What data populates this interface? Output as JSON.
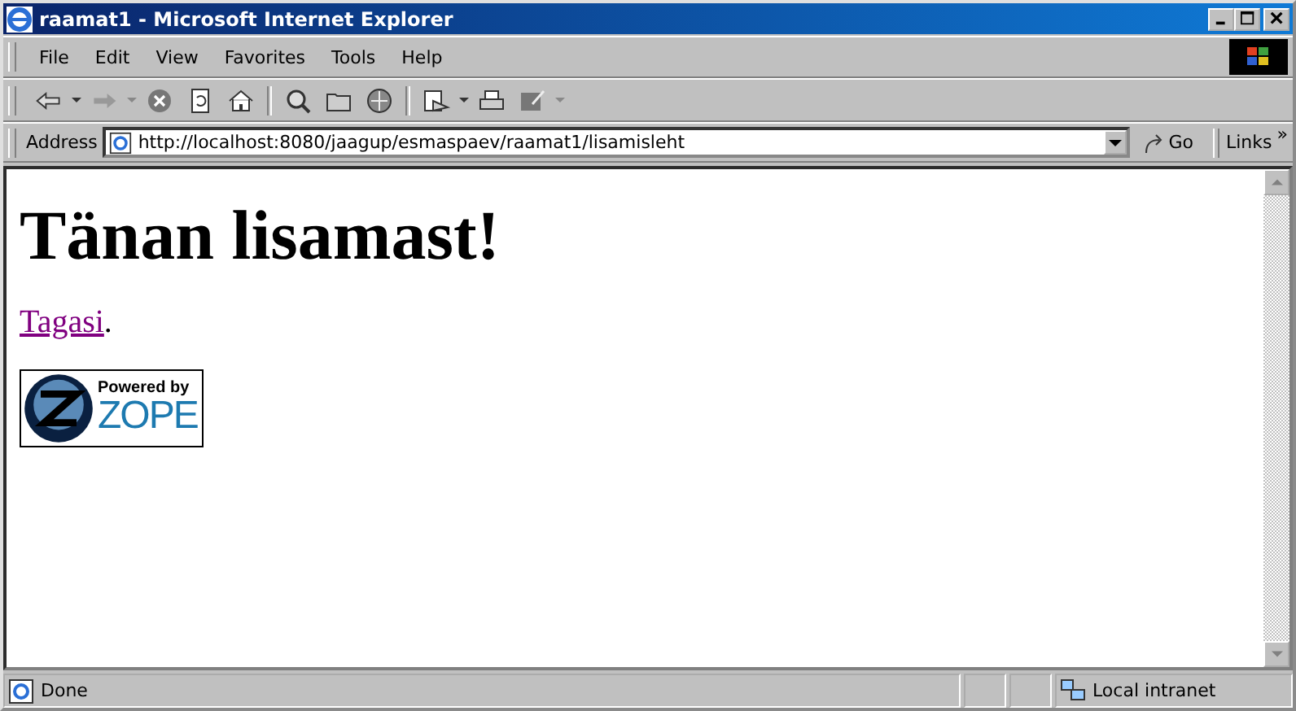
{
  "window": {
    "title": "raamat1 - Microsoft Internet Explorer"
  },
  "menu": [
    "File",
    "Edit",
    "View",
    "Favorites",
    "Tools",
    "Help"
  ],
  "address": {
    "label": "Address",
    "value": "http://localhost:8080/jaagup/esmaspaev/raamat1/lisamisleht",
    "go": "Go",
    "links": "Links",
    "more": "»"
  },
  "page": {
    "heading": "Tänan lisamast!",
    "link": "Tagasi",
    "after": ".",
    "logo_top": "Powered by",
    "logo_name": "ZOPE"
  },
  "status_bar": {
    "text": "Done",
    "zone": "Local intranet"
  }
}
